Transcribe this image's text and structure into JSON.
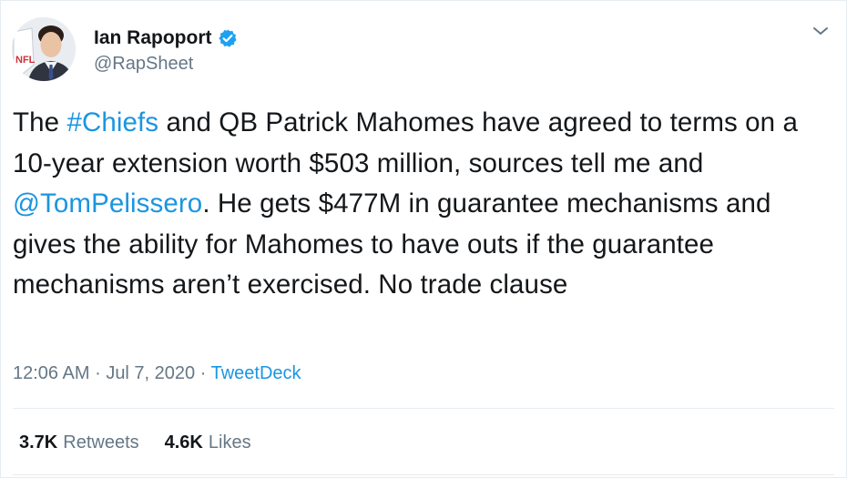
{
  "author": {
    "display_name": "Ian Rapoport",
    "handle": "@RapSheet",
    "verified_icon": "verified-badge-icon",
    "avatar_logo_text": "NFL"
  },
  "tweet": {
    "segments": [
      {
        "text": "The ",
        "link": false
      },
      {
        "text": "#Chiefs",
        "link": true
      },
      {
        "text": " and QB Patrick Mahomes have agreed to terms on a 10-year extension worth $503 million, sources tell me and ",
        "link": false
      },
      {
        "text": "@TomPelissero",
        "link": true
      },
      {
        "text": ". He gets $477M in guarantee mechanisms and gives the ability for Mahomes to have outs if the guarantee mechanisms aren’t exercised. No trade clause",
        "link": false
      }
    ],
    "time": "12:06 AM",
    "separator1": "·",
    "date": "Jul 7, 2020",
    "separator2": "·",
    "source": "TweetDeck"
  },
  "stats": {
    "retweets_count": "3.7K",
    "retweets_label": "Retweets",
    "likes_count": "4.6K",
    "likes_label": "Likes"
  },
  "colors": {
    "link": "#1b95e0",
    "secondary": "#657786",
    "primary_text": "#14171a",
    "divider": "#e6ecf0"
  },
  "icons": {
    "menu": "chevron-down-icon",
    "verified": "verified-badge-icon"
  }
}
